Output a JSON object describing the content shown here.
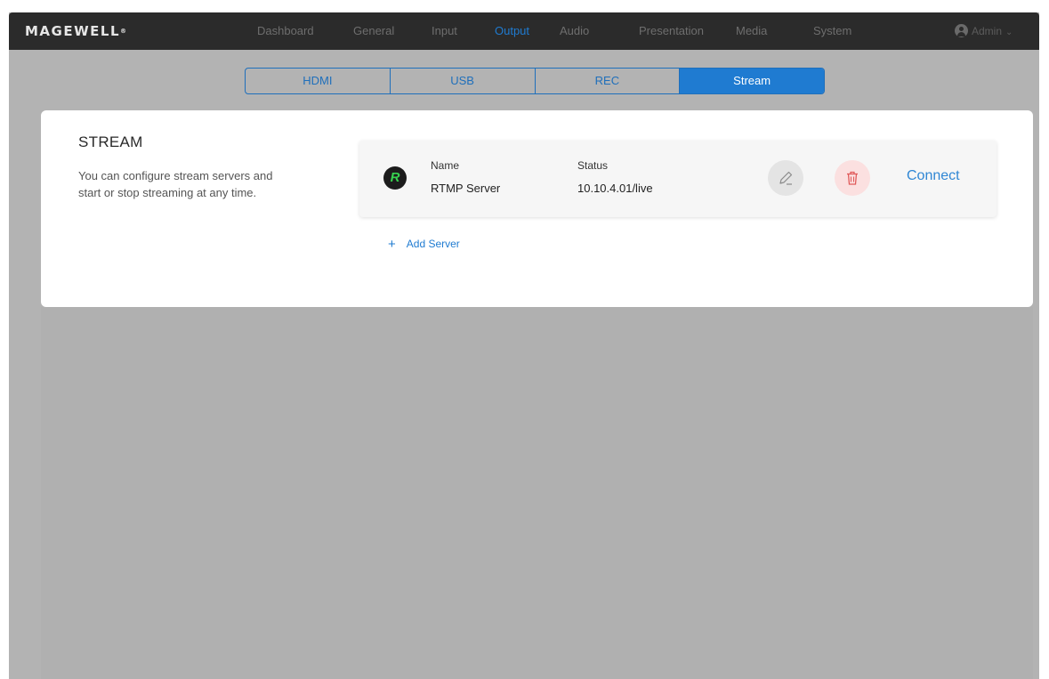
{
  "brand": {
    "logo_text": "MAGEWELL",
    "logo_mark": "®"
  },
  "nav": {
    "items": [
      {
        "label": "Dashboard",
        "active": false
      },
      {
        "label": "General",
        "active": false
      },
      {
        "label": "Input",
        "active": false
      },
      {
        "label": "Output",
        "active": true
      },
      {
        "label": "Audio",
        "active": false
      },
      {
        "label": "Presentation",
        "active": false
      },
      {
        "label": "Media",
        "active": false
      },
      {
        "label": "System",
        "active": false
      }
    ],
    "user": {
      "label": "Admin",
      "icon": "user-avatar-icon",
      "chevron": "chevron-down-icon"
    }
  },
  "subtabs": [
    {
      "label": "HDMI",
      "active": false
    },
    {
      "label": "USB",
      "active": false
    },
    {
      "label": "REC",
      "active": false
    },
    {
      "label": "Stream",
      "active": true
    }
  ],
  "section": {
    "title": "STREAM",
    "description": "You can configure stream servers and start or stop streaming at any time."
  },
  "server": {
    "icon_letter": "R",
    "name_label": "Name",
    "name_value": "RTMP Server",
    "status_label": "Status",
    "status_value": "10.10.4.01/live",
    "connect_label": "Connect",
    "edit_icon": "pencil-icon",
    "delete_icon": "trash-icon"
  },
  "add_server": {
    "plus": "+",
    "label": "Add Server"
  },
  "colors": {
    "accent": "#1f7bd1",
    "nav_bg": "#2b2b2b",
    "overlay": "#b3b3b3",
    "delete_tint": "#fbe0e0",
    "server_logo_green": "#37d24f"
  }
}
